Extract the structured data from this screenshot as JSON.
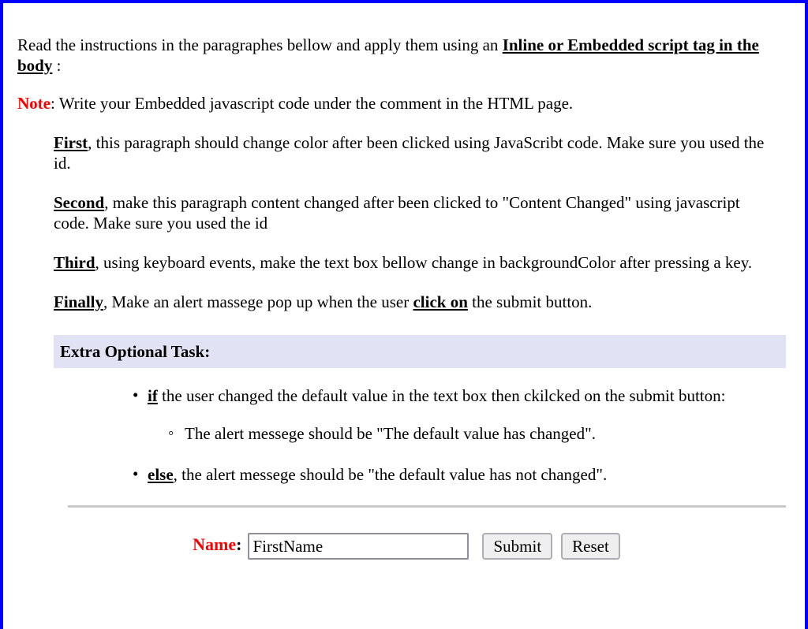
{
  "page": {
    "border_color": "#0000ff",
    "note_color": "#ff0000"
  },
  "intro": {
    "text_before": "Read the instructions in the paragraphes bellow and apply them using an ",
    "emphasis": "Inline or Embedded script tag in the body",
    "text_after": " :"
  },
  "note": {
    "label": "Note",
    "text": ": Write your Embedded javascript code under the comment in the HTML page."
  },
  "instructions": [
    {
      "keyword": "First",
      "text": ", this paragraph should change color after been clicked using JavaScribt code. Make sure you used the id."
    },
    {
      "keyword": "Second",
      "text": ", make this paragraph content changed after been clicked to \"Content Changed\" using javascript code. Make sure you used the id"
    },
    {
      "keyword": "Third",
      "text": ", using keyboard events, make the text box bellow change in backgroundColor after pressing a key."
    },
    {
      "keyword": "Finally",
      "text_1": ", Make an alert massege pop up when the user ",
      "keyword_2": "click on",
      "text_2": " the submit button."
    }
  ],
  "extra": {
    "heading": "Extra Optional Task:",
    "heading_background": "#e2e2f5",
    "bullet_if": {
      "keyword": "if",
      "text": " the user changed the default value in the text box then ckilcked on the submit button:"
    },
    "sub_bullet": {
      "text": "The alert messege should be \"The default value has changed\"."
    },
    "bullet_else": {
      "keyword": "else",
      "text": ", the alert messege should be \"the default value has not changed\"."
    }
  },
  "form": {
    "name_label": "Name",
    "name_colon": ":",
    "name_value": "FirstName",
    "name_placeholder": "FirstName",
    "submit_label": "Submit",
    "reset_label": "Reset"
  }
}
